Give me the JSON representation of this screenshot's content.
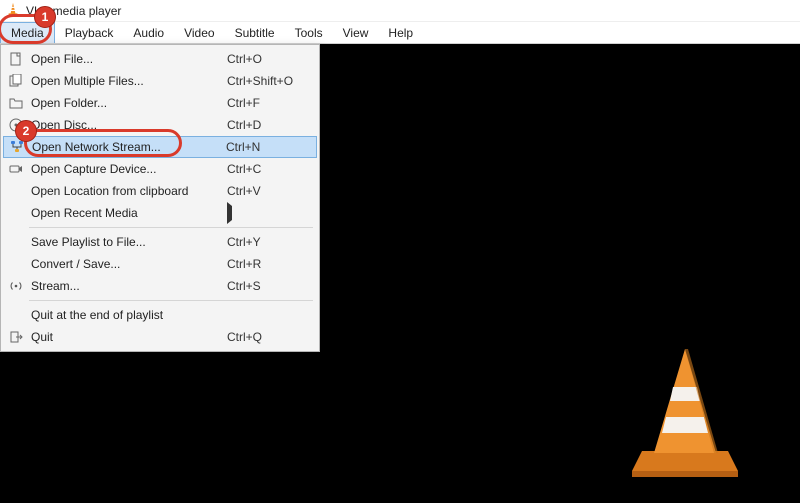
{
  "title": "VLC media player",
  "menubar": [
    {
      "label": "Media",
      "open": true
    },
    {
      "label": "Playback"
    },
    {
      "label": "Audio"
    },
    {
      "label": "Video"
    },
    {
      "label": "Subtitle"
    },
    {
      "label": "Tools"
    },
    {
      "label": "View"
    },
    {
      "label": "Help"
    }
  ],
  "dropdown": [
    {
      "icon": "file",
      "label": "Open File...",
      "shortcut": "Ctrl+O"
    },
    {
      "icon": "files",
      "label": "Open Multiple Files...",
      "shortcut": "Ctrl+Shift+O"
    },
    {
      "icon": "folder",
      "label": "Open Folder...",
      "shortcut": "Ctrl+F"
    },
    {
      "icon": "disc",
      "label": "Open Disc...",
      "shortcut": "Ctrl+D"
    },
    {
      "icon": "network",
      "label": "Open Network Stream...",
      "shortcut": "Ctrl+N",
      "highlight": true
    },
    {
      "icon": "capture",
      "label": "Open Capture Device...",
      "shortcut": "Ctrl+C"
    },
    {
      "icon": "",
      "label": "Open Location from clipboard",
      "shortcut": "Ctrl+V"
    },
    {
      "icon": "",
      "label": "Open Recent Media",
      "submenu": true
    },
    {
      "sep": true
    },
    {
      "icon": "",
      "label": "Save Playlist to File...",
      "shortcut": "Ctrl+Y"
    },
    {
      "icon": "",
      "label": "Convert / Save...",
      "shortcut": "Ctrl+R"
    },
    {
      "icon": "stream",
      "label": "Stream...",
      "shortcut": "Ctrl+S"
    },
    {
      "sep": true
    },
    {
      "icon": "",
      "label": "Quit at the end of playlist",
      "shortcut": ""
    },
    {
      "icon": "quit",
      "label": "Quit",
      "shortcut": "Ctrl+Q"
    }
  ],
  "callouts": [
    {
      "num": "1"
    },
    {
      "num": "2"
    }
  ]
}
